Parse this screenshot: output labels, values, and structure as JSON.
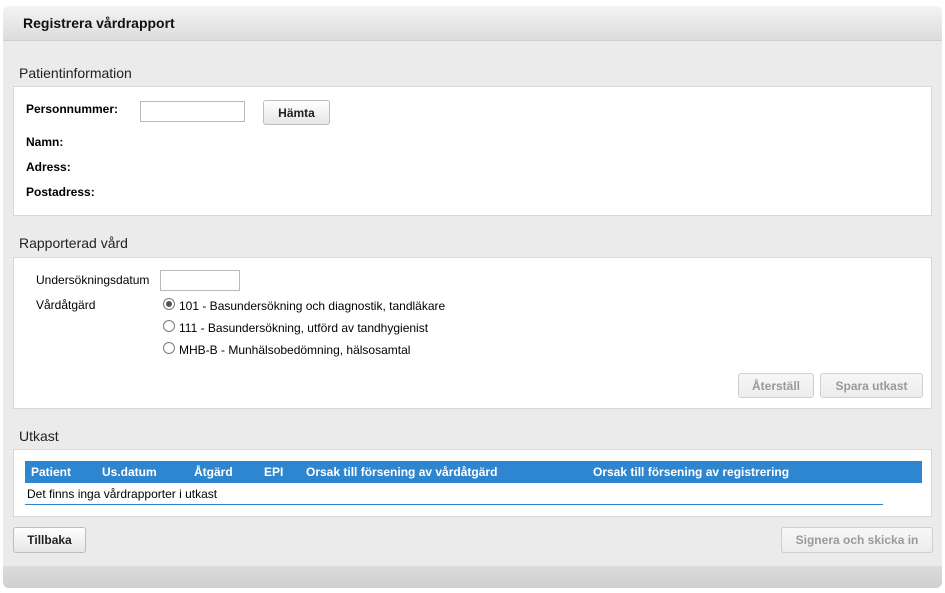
{
  "window": {
    "title": "Registrera vårdrapport"
  },
  "patient": {
    "section_title": "Patientinformation",
    "personnummer_label": "Personnummer:",
    "personnummer_value": "",
    "fetch_button": "Hämta",
    "name_label": "Namn:",
    "address_label": "Adress:",
    "postal_label": "Postadress:"
  },
  "care": {
    "section_title": "Rapporterad vård",
    "date_label": "Undersökningsdatum",
    "date_value": "",
    "action_label": "Vårdåtgärd",
    "options": [
      {
        "label": "101 - Basundersökning och diagnostik, tandläkare",
        "selected": true
      },
      {
        "label": "111 - Basundersökning, utförd av tandhygienist",
        "selected": false
      },
      {
        "label": "MHB-B - Munhälsobedömning, hälsosamtal",
        "selected": false
      }
    ],
    "reset_button": "Återställ",
    "save_draft_button": "Spara utkast"
  },
  "drafts": {
    "section_title": "Utkast",
    "columns": [
      "Patient",
      "Us.datum",
      "Åtgärd",
      "EPI",
      "Orsak till försening av vårdåtgärd",
      "Orsak till försening av registrering"
    ],
    "empty_message": "Det finns inga vårdrapporter i utkast"
  },
  "footer": {
    "back_button": "Tillbaka",
    "sign_button": "Signera och skicka in"
  },
  "colors": {
    "table_header": "#2e86d0",
    "background": "#ebebeb"
  }
}
